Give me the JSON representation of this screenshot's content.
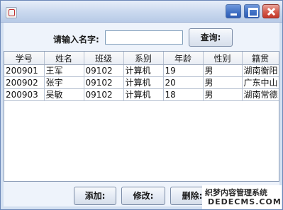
{
  "window": {
    "title": ""
  },
  "search": {
    "label": "请输入名字:",
    "value": "",
    "placeholder": "",
    "button_label": "查询:"
  },
  "table": {
    "columns": [
      "学号",
      "姓名",
      "班级",
      "系别",
      "年龄",
      "性别",
      "籍贯"
    ],
    "rows": [
      [
        "200901",
        "王军",
        "09102",
        "计算机",
        "19",
        "男",
        "湖南衡阳"
      ],
      [
        "200902",
        "张宇",
        "09102",
        "计算机",
        "20",
        "男",
        "广东中山"
      ],
      [
        "200903",
        "吴敏",
        "09102",
        "计算机",
        "18",
        "男",
        "湖南常德"
      ]
    ]
  },
  "actions": {
    "add_label": "添加:",
    "edit_label": "修改:",
    "delete_label": "删除:"
  },
  "watermark": {
    "line1": "织梦内容管理系统",
    "line2": "DEDECMS.COM"
  }
}
